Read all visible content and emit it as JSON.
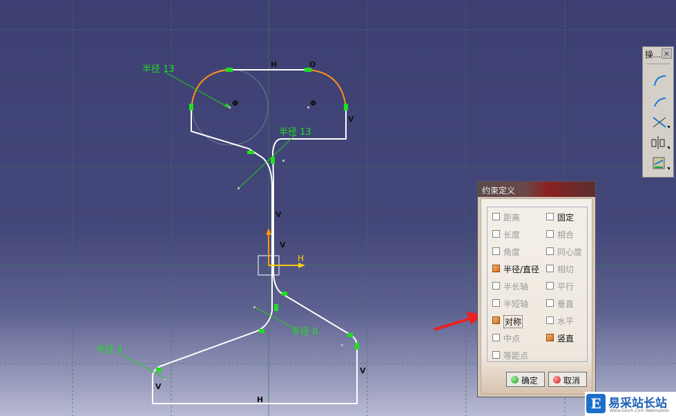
{
  "sketch": {
    "labels": {
      "radius_top_left": "半径 13",
      "radius_mid": "半径 13",
      "radius_bottom_right": "半径 8",
      "radius_bottom_left": "半径 4",
      "H_top": "H",
      "O_top": "O",
      "phi_left": "Φ",
      "phi_right": "Φ",
      "V_right_top": "V",
      "V_web_upper": "V",
      "V_web_lower": "V",
      "H_axis": "H",
      "V_bottom_left": "V",
      "V_bottom_right": "V",
      "H_bottom": "H"
    },
    "colors": {
      "background_top": "#3d3f72",
      "grid": "#3a7a55",
      "profile": "#ffffff",
      "constraint": "#22dd22",
      "selected_arc": "#ff8c1a",
      "axis": "#ff9900"
    }
  },
  "toolbar": {
    "title": "操...",
    "close": "×",
    "buttons": [
      "arc-icon",
      "arc-tangent-icon",
      "trim-icon",
      "symmetry-icon",
      "constraint-icon"
    ]
  },
  "dialog": {
    "title": "约束定义",
    "options": [
      {
        "label": "距离",
        "checked": false,
        "enabled": false
      },
      {
        "label": "固定",
        "checked": false,
        "enabled": true
      },
      {
        "label": "长度",
        "checked": false,
        "enabled": false
      },
      {
        "label": "相合",
        "checked": false,
        "enabled": false
      },
      {
        "label": "角度",
        "checked": false,
        "enabled": false
      },
      {
        "label": "同心度",
        "checked": false,
        "enabled": false
      },
      {
        "label": "半径/直径",
        "checked": true,
        "enabled": true
      },
      {
        "label": "相切",
        "checked": false,
        "enabled": false
      },
      {
        "label": "半长轴",
        "checked": false,
        "enabled": false
      },
      {
        "label": "平行",
        "checked": false,
        "enabled": false
      },
      {
        "label": "半短轴",
        "checked": false,
        "enabled": false
      },
      {
        "label": "垂直",
        "checked": false,
        "enabled": false
      },
      {
        "label": "对称",
        "checked": true,
        "enabled": true
      },
      {
        "label": "水平",
        "checked": false,
        "enabled": false
      },
      {
        "label": "中点",
        "checked": false,
        "enabled": false
      },
      {
        "label": "竖直",
        "checked": true,
        "enabled": true
      },
      {
        "label": "等距点",
        "checked": false,
        "enabled": false
      }
    ],
    "ok_label": "确定",
    "cancel_label": "取消"
  },
  "watermark": {
    "logo": "E",
    "text": "易采站长站",
    "sub": "Www.Easck.Com Webmaster"
  }
}
